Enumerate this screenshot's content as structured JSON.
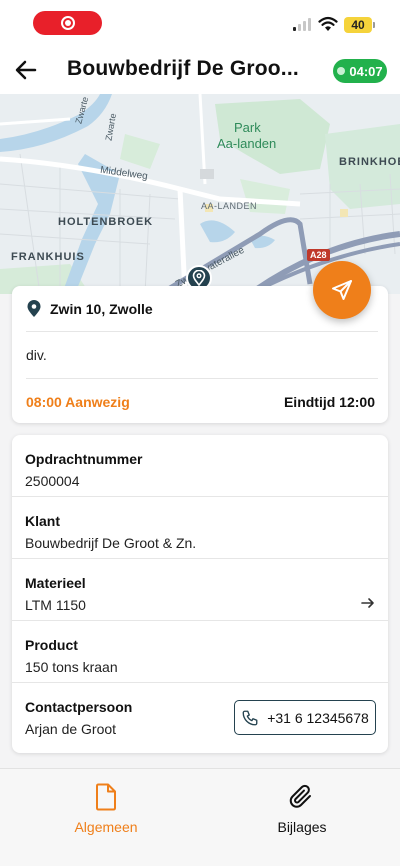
{
  "status_bar": {
    "battery": "40"
  },
  "header": {
    "title": "Bouwbedrijf De Groo...",
    "timer": "04:07"
  },
  "map": {
    "labels": {
      "park": "Park",
      "aa_landen_park": "Aa-landen",
      "brinkhoe": "BRINKHOE",
      "middelweg": "Middelweg",
      "aa_landen": "AA-LANDEN",
      "holtenbroek": "HOLTENBROEK",
      "frankhuis": "FRANKHUIS",
      "zwartewaterallee": "Zwartewaterallee",
      "zwarte_w": "Zwarte W",
      "zwarte": "Zwarte",
      "a28": "A28"
    }
  },
  "job": {
    "address": "Zwin 10, Zwolle",
    "description": "div.",
    "presence": "08:00 Aanwezig",
    "end_time": "Eindtijd 12:00"
  },
  "details": {
    "fields": [
      {
        "label": "Opdrachtnummer",
        "value": "2500004"
      },
      {
        "label": "Klant",
        "value": "Bouwbedrijf De Groot & Zn."
      },
      {
        "label": "Materieel",
        "value": "LTM 1150"
      },
      {
        "label": "Product",
        "value": "150 tons kraan"
      },
      {
        "label": "Contactpersoon",
        "value": "Arjan de Groot"
      }
    ],
    "phone": "+31 6 12345678"
  },
  "nav": {
    "general": "Algemeen",
    "attachments": "Bijlages"
  },
  "colors": {
    "accent": "#ef7f1a",
    "timer_green": "#22b14c",
    "pin_dark": "#24424f"
  }
}
